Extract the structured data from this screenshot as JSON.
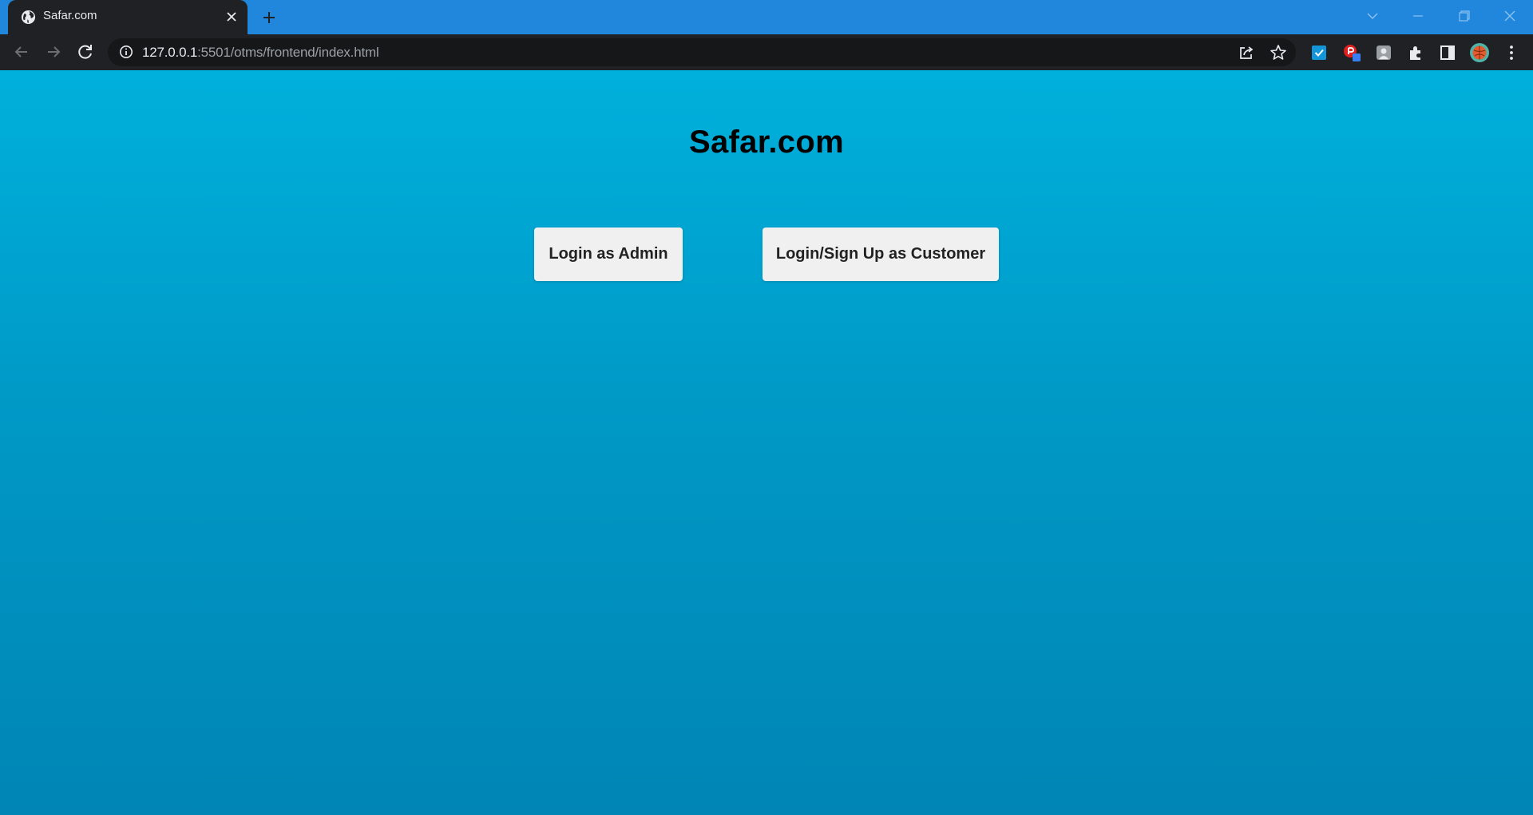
{
  "browser": {
    "tab": {
      "title": "Safar.com"
    },
    "url": {
      "host": "127.0.0.1",
      "rest": ":5501/otms/frontend/index.html"
    }
  },
  "colors": {
    "tabstrip": "#2187dc",
    "toolbar": "#202124",
    "page_gradient_top": "#00b0dc",
    "page_gradient_bottom": "#0085b5",
    "button_bg": "#f0f0f0"
  },
  "icons": {
    "tab_favicon": "globe-icon",
    "tab_close": "close-icon",
    "new_tab": "plus-icon",
    "back": "arrow-left-icon",
    "forward": "arrow-right-icon",
    "reload": "reload-icon",
    "site_info": "info-icon",
    "share": "share-icon",
    "bookmark": "star-icon",
    "extensions": "puzzle-icon",
    "side_panel": "side-panel-icon",
    "menu": "kebab-menu-icon"
  },
  "page": {
    "title": "Safar.com",
    "buttons": {
      "admin": "Login as Admin",
      "customer": "Login/Sign Up as Customer"
    }
  }
}
